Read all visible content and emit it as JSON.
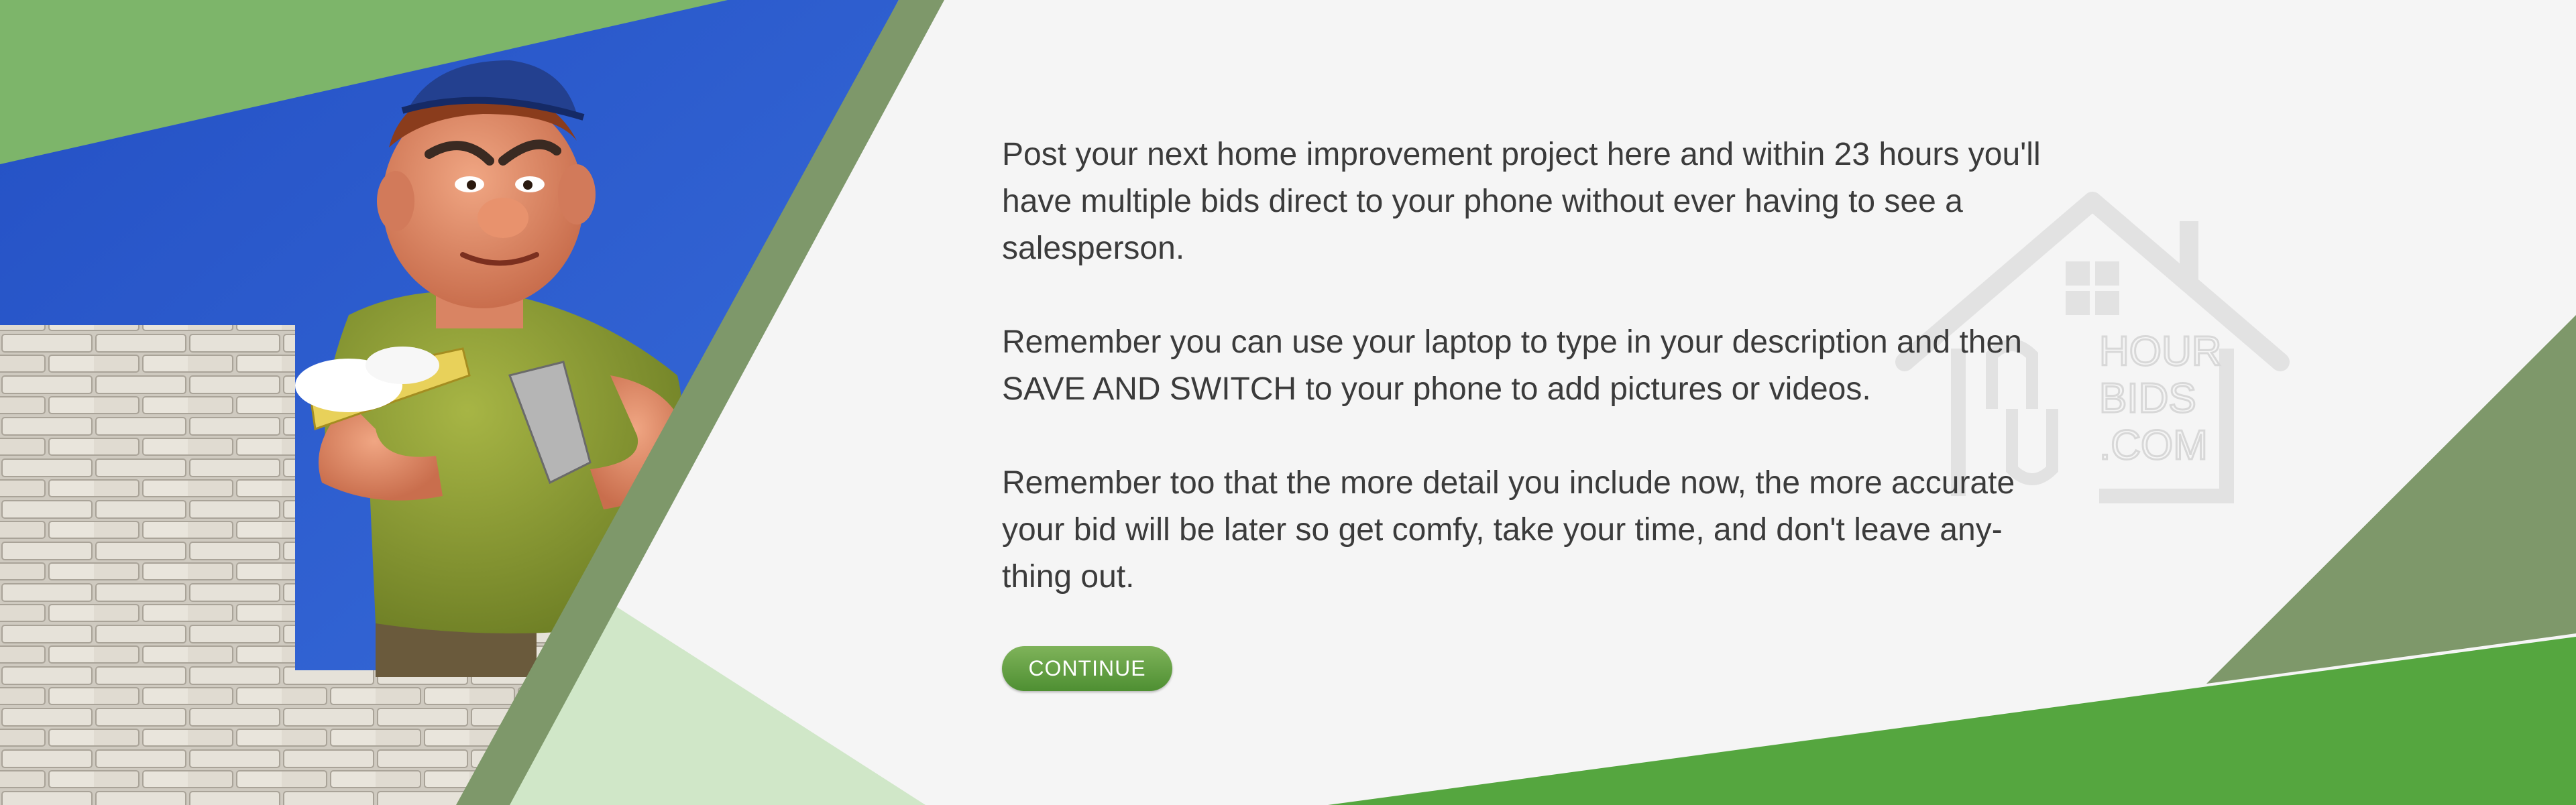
{
  "intro": {
    "paragraphs": [
      "Post your next home improvement project here and within 23 hours you'll have multiple bids direct to your phone without ever having to see a salesperson.",
      "Remember you can use your laptop to type in your description and then SAVE AND SWITCH to your phone to add pictures or videos.",
      "Remember too that the more detail you include now, the more accurate your bid will be later so get comfy, take your time, and don't leave any-thing out."
    ],
    "continue_label": "CONTINUE"
  },
  "watermark": {
    "line1": "HOUR",
    "line2": "BIDS",
    "line3": ".COM",
    "icon": "house-logo-icon"
  },
  "photo": {
    "subject": "builder-figurine-photo",
    "icon": "brick-wall-icon"
  },
  "colors": {
    "background": "#f5f5f5",
    "green_light": "#7db56a",
    "green_mid": "#7e986a",
    "green_bright": "#55a63f",
    "green_pale": "#d0e7c8",
    "sky_blue": "#2c57c4",
    "text": "#3b3b3b",
    "button_top": "#7fb35a",
    "button_bottom": "#4e8f32"
  }
}
